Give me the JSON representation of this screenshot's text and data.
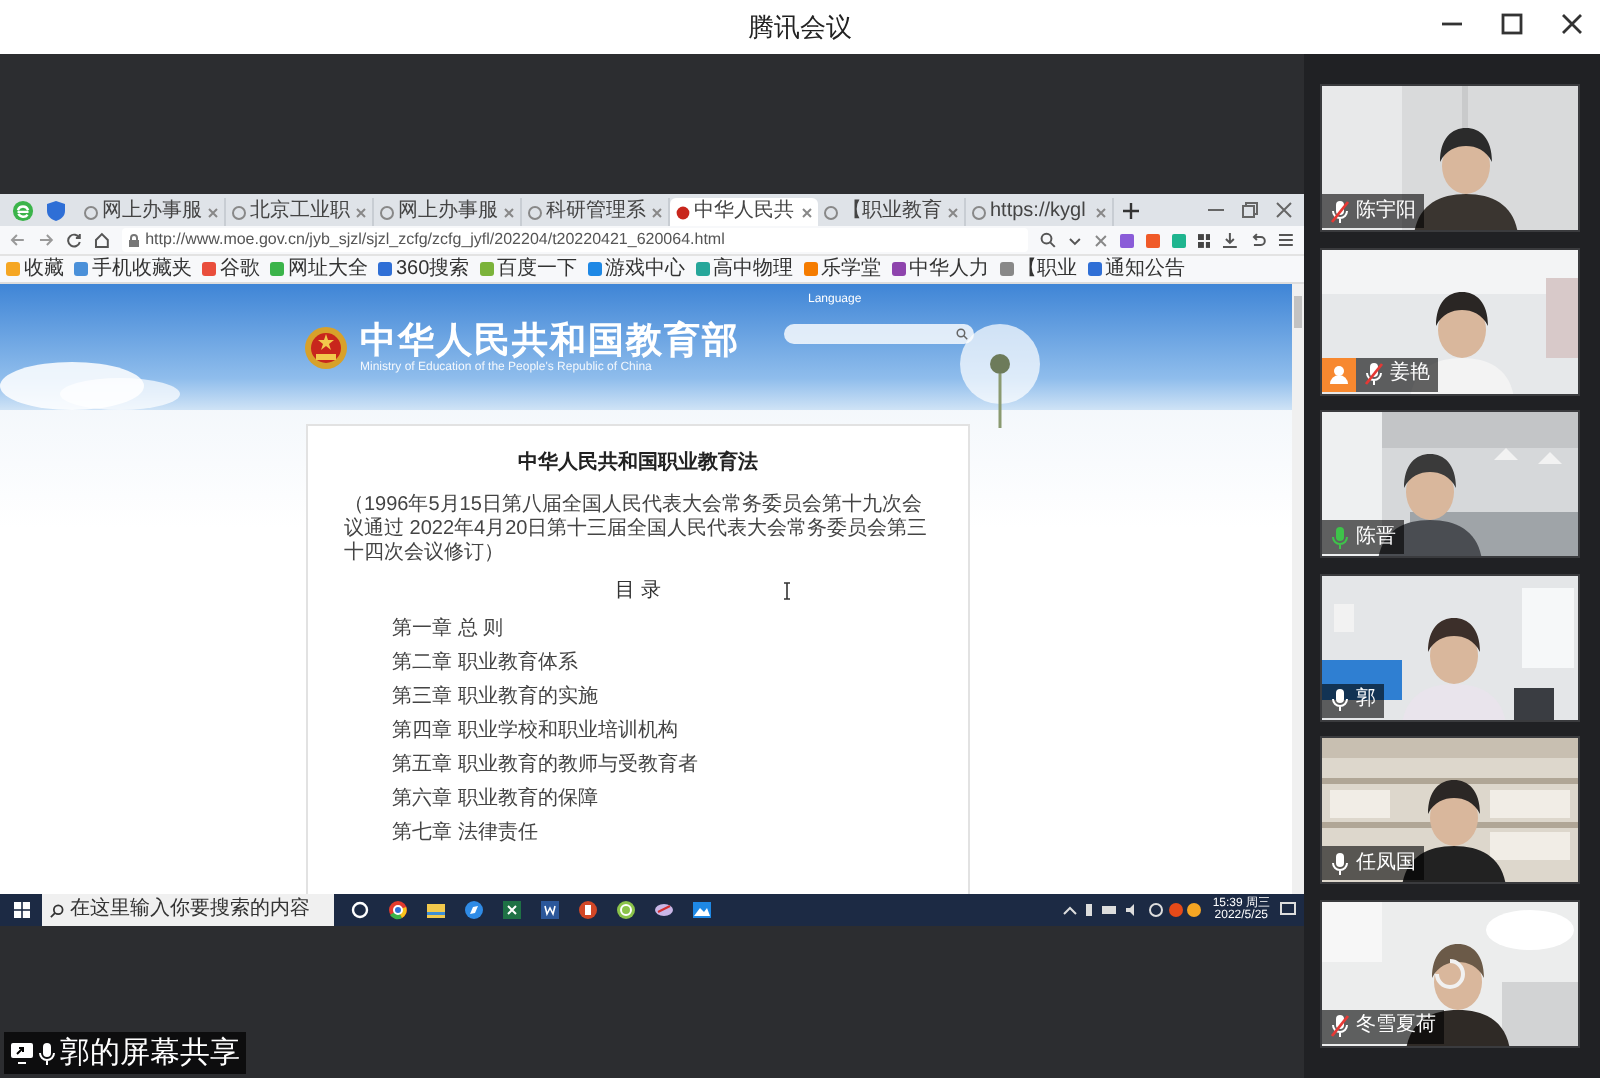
{
  "window": {
    "title": "腾讯会议"
  },
  "browser": {
    "tabs": [
      {
        "label": "网上办事服",
        "selected": false
      },
      {
        "label": "北京工业职",
        "selected": false
      },
      {
        "label": "网上办事服",
        "selected": false
      },
      {
        "label": "科研管理系",
        "selected": false
      },
      {
        "label": "中华人民共",
        "selected": true
      },
      {
        "label": "【职业教育",
        "selected": false
      },
      {
        "label": "https://kygl",
        "selected": false
      }
    ],
    "url": "http://www.moe.gov.cn/jyb_sjzl/sjzl_zcfg/zcfg_jyfl/202204/t20220421_620064.html",
    "bookmarks": [
      "收藏",
      "手机收藏夹",
      "谷歌",
      "网址大全",
      "360搜索",
      "百度一下",
      "游戏中心",
      "高中物理",
      "乐学堂",
      "中华人力",
      "【职业",
      "通知公告"
    ]
  },
  "page": {
    "site_title": "中华人民共和国教育部",
    "site_subtitle": "Ministry of Education of the People's Republic of China",
    "header_link": "Language",
    "document": {
      "title": "中华人民共和国职业教育法",
      "preamble": "（1996年5月15日第八届全国人民代表大会常务委员会第十九次会议通过 2022年4月20日第十三届全国人民代表大会常务委员会第三十四次会议修订）",
      "toc_heading": "目 录",
      "chapters": [
        "第一章 总 则",
        "第二章 职业教育体系",
        "第三章 职业教育的实施",
        "第四章 职业学校和职业培训机构",
        "第五章 职业教育的教师与受教育者",
        "第六章 职业教育的保障",
        "第七章 法律责任"
      ]
    }
  },
  "taskbar": {
    "search_placeholder": "在这里输入你要搜索的内容",
    "time": "15:39 周三",
    "date": "2022/5/25"
  },
  "share_label": "郭的屏幕共享",
  "participants": [
    {
      "name": "陈宇阳",
      "muted": true,
      "speaking": false,
      "host_icon": false,
      "loading": false
    },
    {
      "name": "姜艳",
      "muted": true,
      "speaking": false,
      "host_icon": true,
      "loading": false
    },
    {
      "name": "陈晋",
      "muted": false,
      "speaking": true,
      "host_icon": false,
      "loading": false
    },
    {
      "name": "郭",
      "muted": false,
      "speaking": false,
      "host_icon": false,
      "loading": false
    },
    {
      "name": "任凤国",
      "muted": false,
      "speaking": false,
      "host_icon": false,
      "loading": false
    },
    {
      "name": "冬雪夏荷",
      "muted": true,
      "speaking": false,
      "host_icon": false,
      "loading": true
    }
  ]
}
